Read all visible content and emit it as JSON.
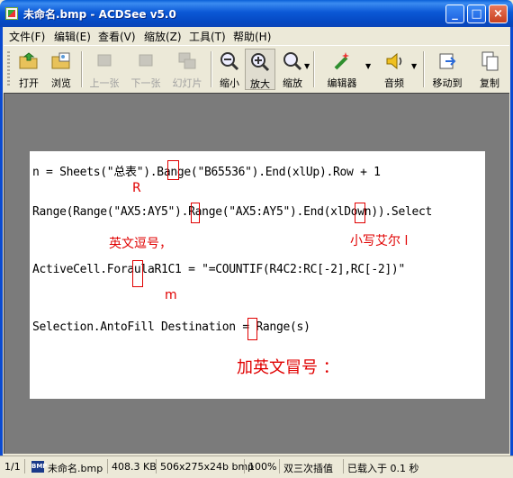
{
  "window": {
    "title": "未命名.bmp - ACDSee v5.0"
  },
  "titlebar_buttons": {
    "minimize": "_",
    "maximize": "□",
    "close": "×"
  },
  "menu": [
    "文件(F)",
    "编辑(E)",
    "查看(V)",
    "缩放(Z)",
    "工具(T)",
    "帮助(H)"
  ],
  "toolbar": {
    "open": "打开",
    "browse": "浏览",
    "prev": "上一张",
    "next": "下一张",
    "slideshow": "幻灯片",
    "zoom_out": "缩小",
    "zoom_in": "放大",
    "zoom": "缩放",
    "editor": "编辑器",
    "audio": "音频",
    "move_to": "移动到",
    "copy": "复制"
  },
  "document": {
    "line1": "n = Sheets(\"总表\").Bange(\"B65536\").End(xlUp).Row + 1",
    "line2": "Range(Range(\"AX5:AY5\").Range(\"AX5:AY5\").End(xlDown)).Select",
    "line3": "ActiveCell.ForaulaR1C1 = \"=COUNTIF(R4C2:RC[-2],RC[-2])\"",
    "line4": "Selection.AntoFill Destination = Range(s)"
  },
  "annotations": {
    "r_note": "R",
    "comma_note": "英文逗号，",
    "lower_l_note": "小写艾尔 l",
    "m_note": "m",
    "colon_note": "加英文冒号 ："
  },
  "status": {
    "index": "1/1",
    "file_type": "BMP",
    "filename": "未命名.bmp",
    "size": "408.3 KB",
    "dims": "506x275x24b bmp",
    "zoom": "100%",
    "mode": "双三次插值",
    "load": "已载入于 0.1 秒"
  },
  "colors": {
    "annotation": "#e00000",
    "title_bar": "#0a58d6"
  }
}
